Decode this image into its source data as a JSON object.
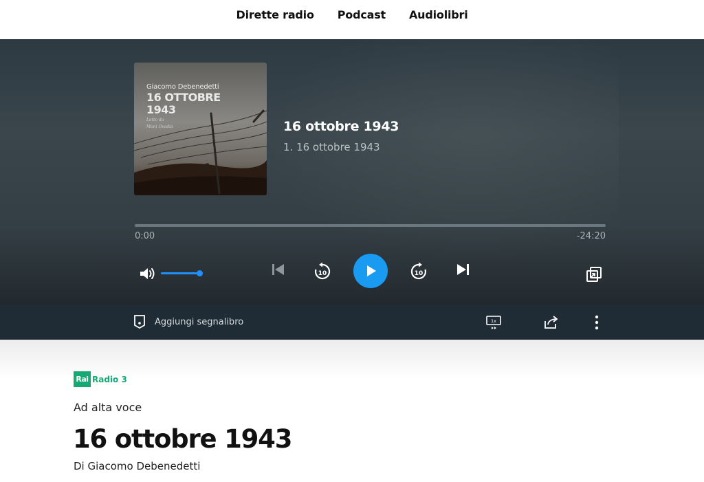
{
  "nav": {
    "items": [
      {
        "label": "Dirette radio"
      },
      {
        "label": "Podcast"
      },
      {
        "label": "Audiolibri"
      }
    ]
  },
  "player": {
    "cover": {
      "author": "Giacomo Debenedetti",
      "title_line1": "16 OTTOBRE",
      "title_line2": "1943",
      "reader_line1": "Letto da",
      "reader_line2": "Moni Ovadia"
    },
    "track_title": "16 ottobre 1943",
    "track_subtitle": "1. 16 ottobre 1943",
    "time_elapsed": "0:00",
    "time_remaining": "-24:20",
    "progress_fraction": 0.0,
    "volume_fraction": 1.0,
    "colors": {
      "accent": "#1a9bf2",
      "volume": "#1e90ff"
    },
    "icons": {
      "volume": "volume-icon",
      "previous": "skip-previous-icon",
      "rewind": "rewind-10-icon",
      "play": "play-icon",
      "forward": "forward-10-icon",
      "next": "skip-next-icon",
      "popout": "popout-icon"
    }
  },
  "actions": {
    "bookmark_label": "Aggiungi segnalibro",
    "speed_label": "1x",
    "icons": {
      "bookmark": "bookmark-icon",
      "speed": "playback-speed-icon",
      "share": "share-icon",
      "more": "more-vertical-icon"
    }
  },
  "content": {
    "logo_rai": "Rai",
    "logo_channel": "Radio 3",
    "program": "Ad alta voce",
    "episode_title": "16 ottobre 1943",
    "author": "Di Giacomo Debenedetti",
    "colors": {
      "brand": "#17a974"
    }
  }
}
